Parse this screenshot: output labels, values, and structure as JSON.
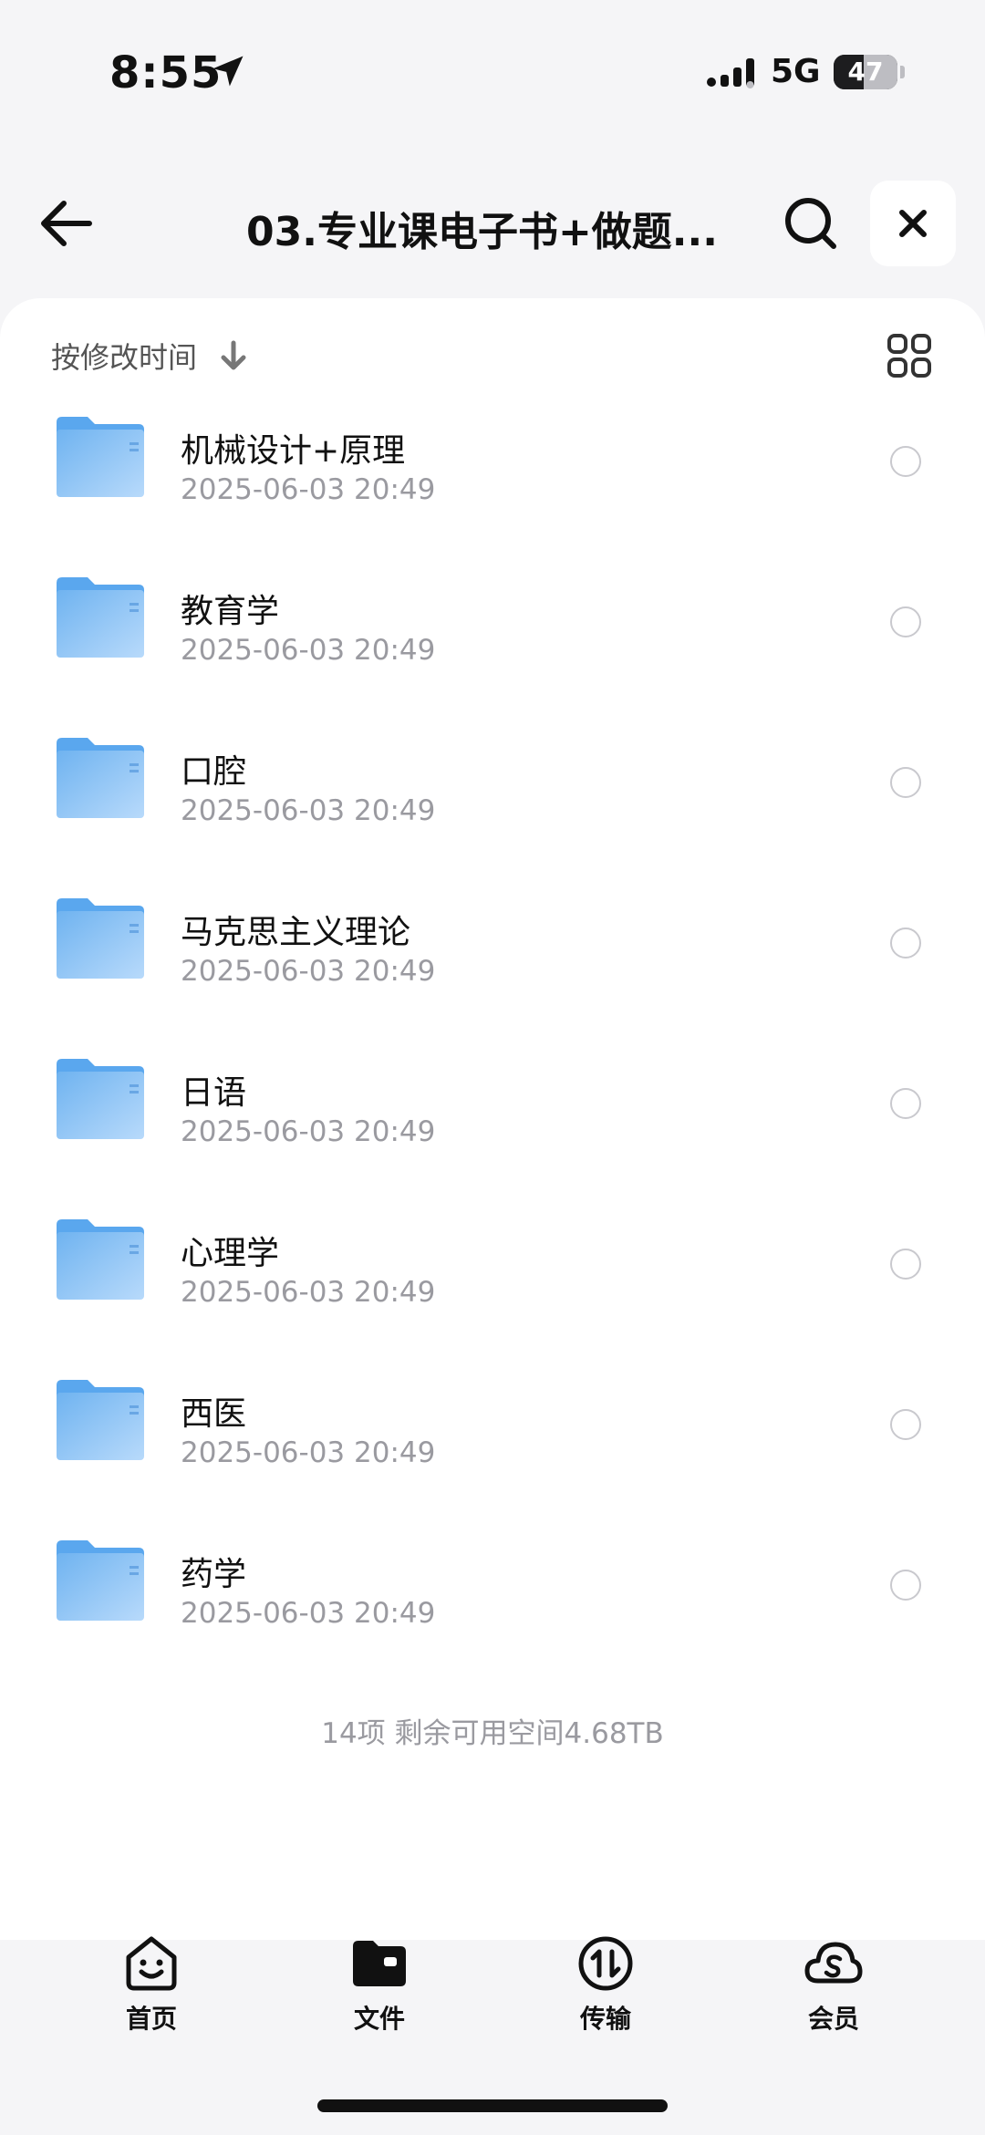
{
  "status": {
    "time": "8:55",
    "network": "5G",
    "battery": "47",
    "battery_level": 0.47
  },
  "nav": {
    "title": "03.专业课电子书+做题..."
  },
  "sort": {
    "label": "按修改时间"
  },
  "folders": [
    {
      "name": "机械设计+原理",
      "date": "2025-06-03 20:49"
    },
    {
      "name": "教育学",
      "date": "2025-06-03 20:49"
    },
    {
      "name": "口腔",
      "date": "2025-06-03 20:49"
    },
    {
      "name": "马克思主义理论",
      "date": "2025-06-03 20:49"
    },
    {
      "name": "日语",
      "date": "2025-06-03 20:49"
    },
    {
      "name": "心理学",
      "date": "2025-06-03 20:49"
    },
    {
      "name": "西医",
      "date": "2025-06-03 20:49"
    },
    {
      "name": "药学",
      "date": "2025-06-03 20:49"
    }
  ],
  "footer": {
    "info": "14项 剩余可用空间4.68TB"
  },
  "tabs": [
    {
      "label": "首页",
      "icon": "smile-face-icon"
    },
    {
      "label": "文件",
      "icon": "folder-icon"
    },
    {
      "label": "传输",
      "icon": "transfer-icon"
    },
    {
      "label": "会员",
      "icon": "cloud-s-icon"
    }
  ],
  "colors": {
    "folder": "#5aa7ee",
    "folder_light": "#b8dafb",
    "accent": "#111111"
  }
}
